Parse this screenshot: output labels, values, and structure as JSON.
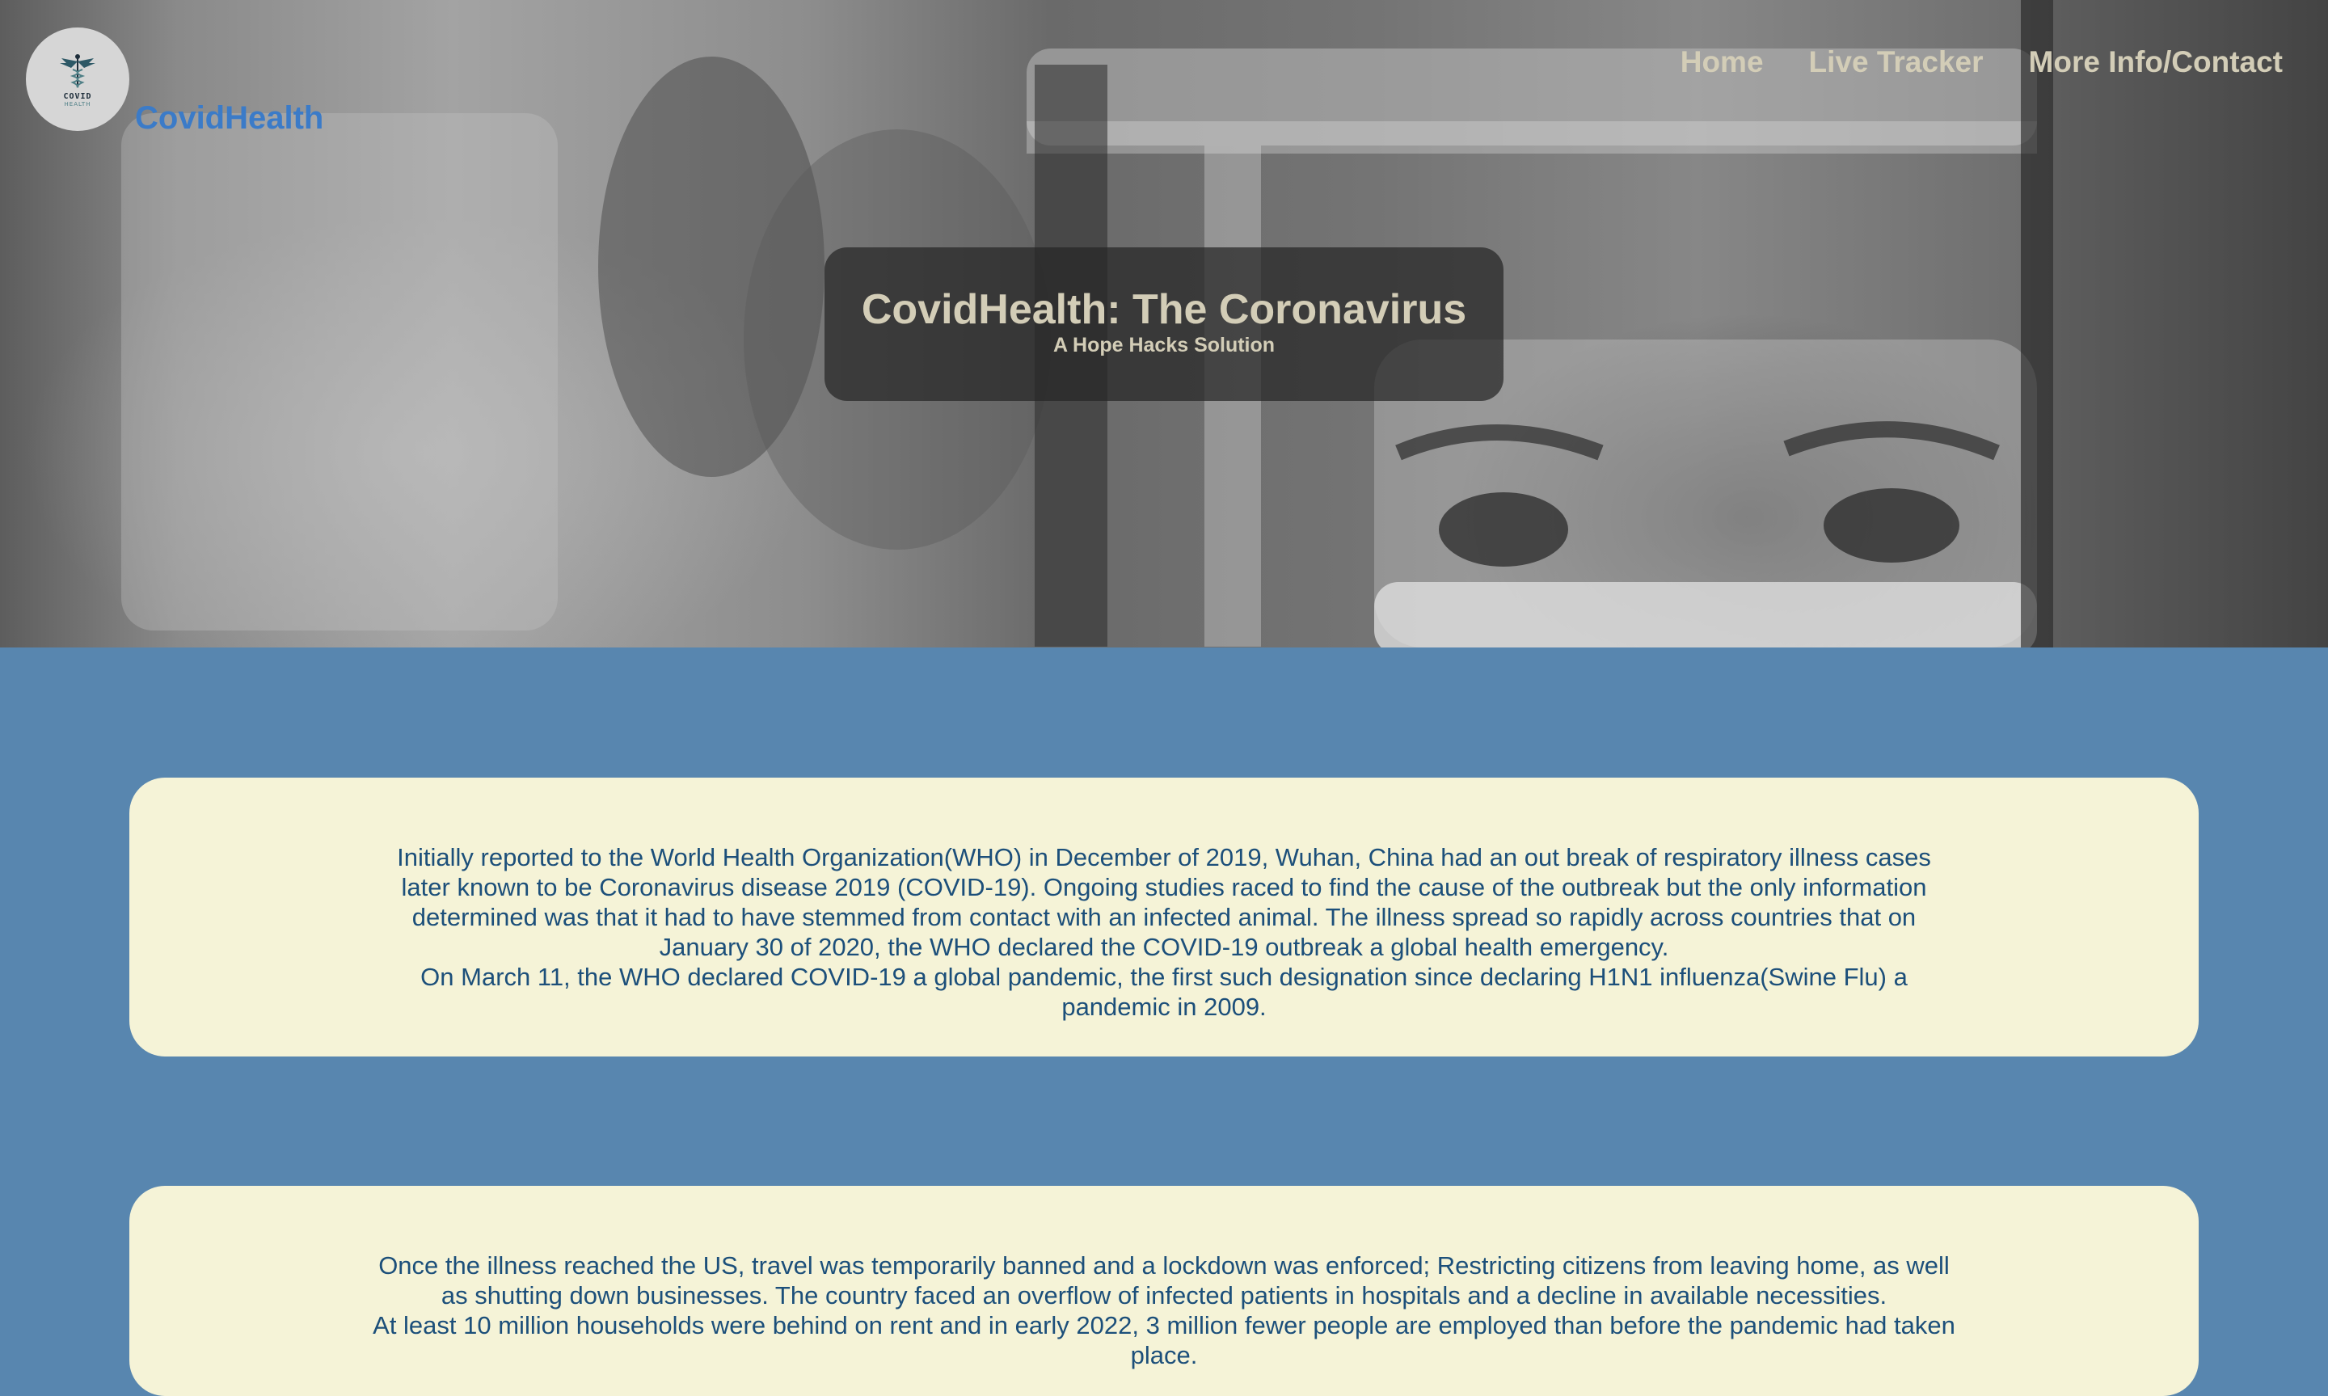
{
  "brand": {
    "logo_word": "COVID",
    "logo_sub": "HEALTH",
    "name": "CovidHealth"
  },
  "nav": {
    "items": [
      "Home",
      "Live Tracker",
      "More Info/Contact"
    ]
  },
  "hero": {
    "title": "CovidHealth: The Coronavirus",
    "subtitle": "A Hope Hacks Solution"
  },
  "cards": [
    {
      "paragraphs": [
        "Initially reported to the World Health Organization(WHO) in December of 2019, Wuhan, China had an out break of respiratory illness cases later known to be Coronavirus disease 2019 (COVID-19). Ongoing studies raced to find the cause of the outbreak but the only information determined was that it had to have stemmed from contact with an infected animal. The illness spread so rapidly across countries that on January 30 of 2020, the WHO declared the COVID-19 outbreak a global health emergency.",
        "On March 11, the WHO declared COVID-19 a global pandemic, the first such designation since declaring H1N1 influenza(Swine Flu) a pandemic in 2009."
      ]
    },
    {
      "paragraphs": [
        "Once the illness reached the US, travel was temporarily banned and a lockdown was enforced; Restricting citizens from leaving home, as well as shutting down businesses. The country faced an overflow of infected patients in hospitals and a decline in available necessities.",
        "At least 10 million households were behind on rent and in early 2022, 3 million fewer people are employed than before the pandemic had taken place."
      ]
    }
  ],
  "colors": {
    "page_background": "#5886af",
    "card_background": "#f5f3d7",
    "card_text": "#1c4f7a",
    "brand_text": "#3b7bc8",
    "nav_text": "#d3cdb7"
  }
}
